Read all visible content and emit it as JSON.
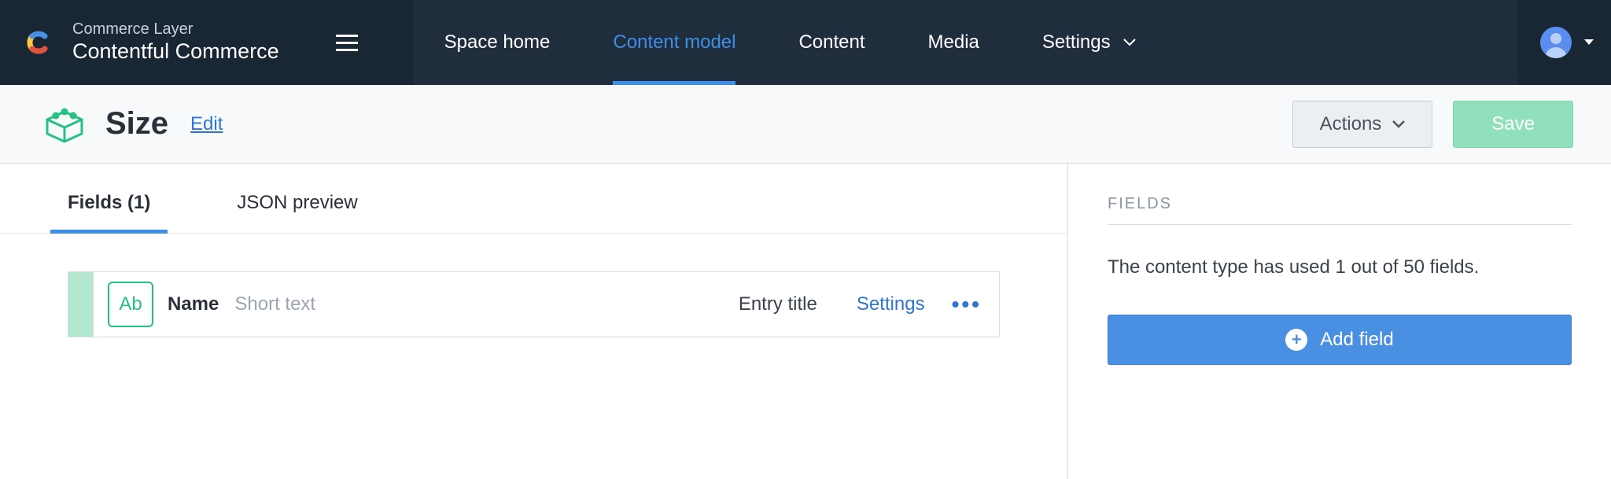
{
  "brand": {
    "subtitle": "Commerce Layer",
    "title": "Contentful Commerce"
  },
  "nav": {
    "items": [
      {
        "label": "Space home",
        "active": false
      },
      {
        "label": "Content model",
        "active": true
      },
      {
        "label": "Content",
        "active": false
      },
      {
        "label": "Media",
        "active": false
      },
      {
        "label": "Settings",
        "active": false,
        "has_dropdown": true
      }
    ]
  },
  "page": {
    "title": "Size",
    "edit_label": "Edit",
    "actions_label": "Actions",
    "save_label": "Save"
  },
  "tabs": [
    {
      "label": "Fields (1)",
      "active": true
    },
    {
      "label": "JSON preview",
      "active": false
    }
  ],
  "fields_list": [
    {
      "type_badge": "Ab",
      "name": "Name",
      "type_label": "Short text",
      "entry_title_label": "Entry title",
      "settings_label": "Settings"
    }
  ],
  "sidebar": {
    "heading": "FIELDS",
    "usage_text": "The content type has used 1 out of 50 fields.",
    "add_field_label": "Add field"
  }
}
